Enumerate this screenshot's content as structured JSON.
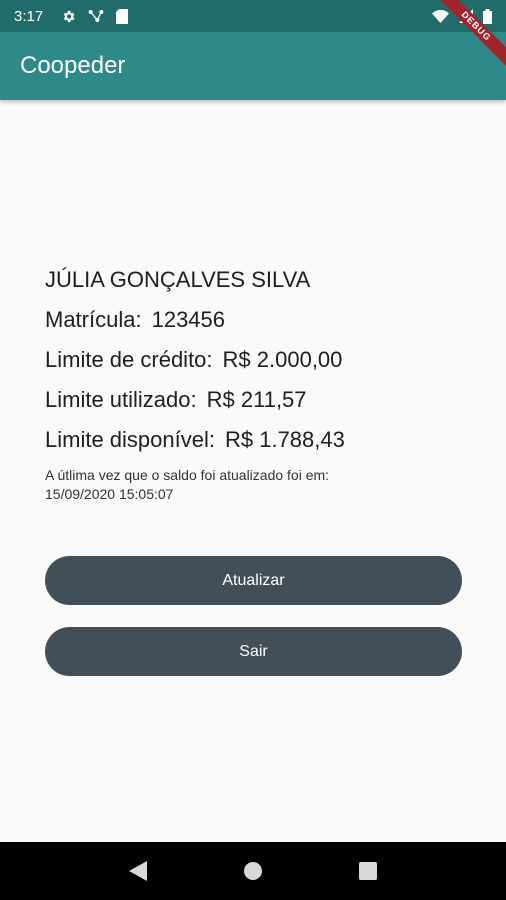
{
  "status_bar": {
    "time": "3:17",
    "icons_left": [
      "gear-icon",
      "share-icon",
      "sd-card-icon"
    ],
    "icons_right": [
      "wifi-icon",
      "signal-icon",
      "battery-icon"
    ]
  },
  "debug_banner": "DEBUG",
  "app_bar": {
    "title": "Coopeder",
    "color": "#2d8a89"
  },
  "profile": {
    "name": "JÚLIA GONÇALVES SILVA",
    "matricula_label": "Matrícula:",
    "matricula_value": "123456",
    "limite_credito_label": "Limite de crédito:",
    "limite_credito_value": "R$ 2.000,00",
    "limite_utilizado_label": "Limite utilizado:",
    "limite_utilizado_value": "R$ 211,57",
    "limite_disponivel_label": "Limite disponível:",
    "limite_disponivel_value": "R$ 1.788,43"
  },
  "note": {
    "line1": "A útlima vez que o saldo foi atualizado foi em:",
    "line2": "15/09/2020 15:05:07"
  },
  "buttons": {
    "update_label": "Atualizar",
    "exit_label": "Sair",
    "color": "#424f58"
  },
  "nav_bar": {
    "icons": [
      "back-icon",
      "home-icon",
      "recents-icon"
    ]
  }
}
